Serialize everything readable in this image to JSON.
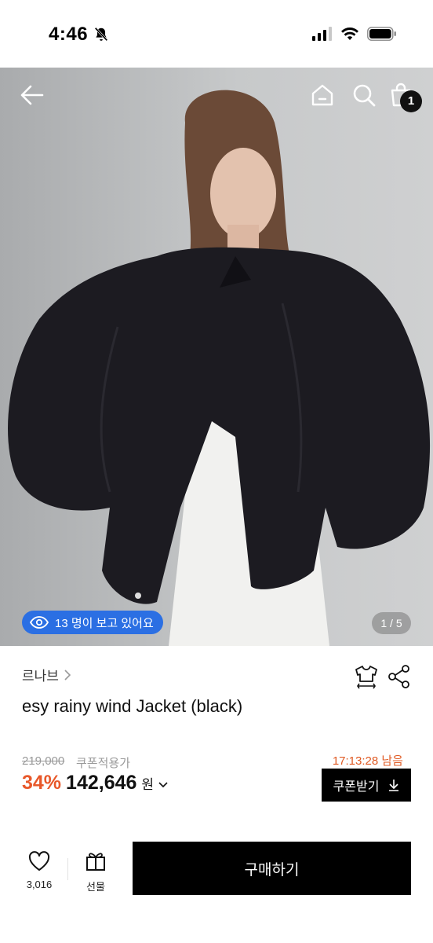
{
  "status_bar": {
    "time": "4:46"
  },
  "hero": {
    "viewers_text": "13 명이 보고 있어요",
    "page_counter": "1 / 5",
    "cart_count": "1"
  },
  "product": {
    "brand": "르나브",
    "title": "esy rainy wind Jacket (black)",
    "original_price": "219,000",
    "coupon_price_label": "쿠폰적용가",
    "timer": "17:13:28 남음",
    "discount": "34%",
    "price": "142,646",
    "currency": "원",
    "coupon_button": "쿠폰받기"
  },
  "bottom_bar": {
    "like_count": "3,016",
    "gift_label": "선물",
    "buy_label": "구매하기"
  },
  "colors": {
    "accent_orange": "#e8582a",
    "viewers_blue": "#2b6fe3",
    "primary_black": "#000000"
  }
}
